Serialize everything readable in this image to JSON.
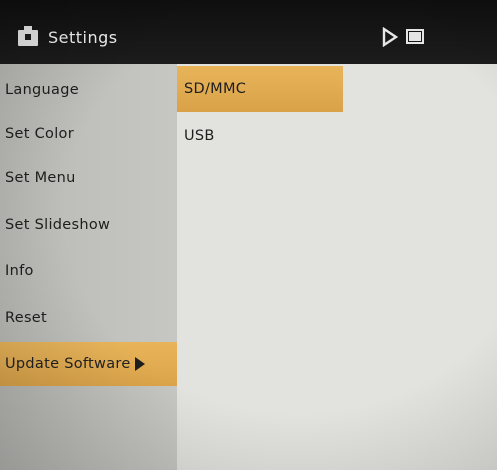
{
  "header": {
    "title": "Settings",
    "icons": [
      "settings-icon",
      "play-icon",
      "memory-card-icon"
    ]
  },
  "menu": {
    "items": [
      {
        "label": "Language"
      },
      {
        "label": "Set Color"
      },
      {
        "label": "Set Menu"
      },
      {
        "label": "Set Slideshow"
      },
      {
        "label": "Info"
      },
      {
        "label": "Reset"
      },
      {
        "label": "Update Software",
        "selected": true,
        "icon": "arrow-right-icon"
      }
    ]
  },
  "submenu": {
    "options": [
      {
        "label": "SD/MMC",
        "selected": true
      },
      {
        "label": "USB"
      }
    ]
  },
  "colors": {
    "highlight": "#e3ad52",
    "header": "#151515",
    "sidebar": "#bfc0bb",
    "content": "#e2e3df"
  }
}
